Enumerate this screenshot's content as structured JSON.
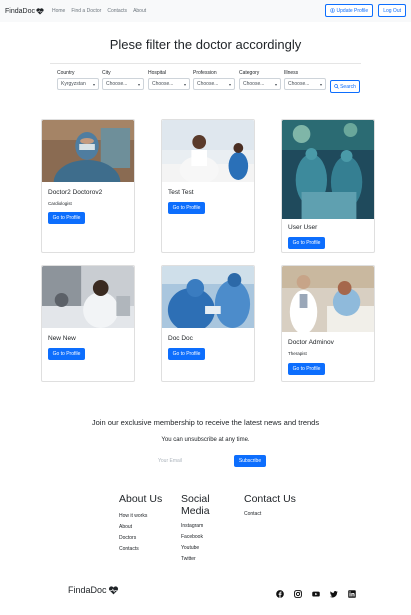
{
  "navbar": {
    "brand": "FindaDoc",
    "links": [
      "Home",
      "Find a Doctor",
      "Contacts",
      "About"
    ],
    "update_profile": "Update Profile",
    "logout": "Log Out"
  },
  "page_title": "Plese filter the doctor accordingly",
  "filters": [
    {
      "label": "Country",
      "value": "Kyrgyzstan"
    },
    {
      "label": "City",
      "value": "Choose..."
    },
    {
      "label": "Hospital",
      "value": "Choose..."
    },
    {
      "label": "Profession",
      "value": "Choose..."
    },
    {
      "label": "Category",
      "value": "Choose..."
    },
    {
      "label": "Illness",
      "value": "Choose..."
    }
  ],
  "search_label": "Search",
  "doctors": [
    {
      "name": "Doctor2 Doctorov2",
      "specialty": "Cardiologist",
      "button": "Go to Profile"
    },
    {
      "name": "Test Test",
      "specialty": "",
      "button": "Go to Profile"
    },
    {
      "name": "User User",
      "specialty": "",
      "button": "Go to Profile"
    },
    {
      "name": "New New",
      "specialty": "",
      "button": "Go to Profile"
    },
    {
      "name": "Doc Doc",
      "specialty": "",
      "button": "Go to Profile"
    },
    {
      "name": "Doctor Adminov",
      "specialty": "Therapist",
      "button": "Go to Profile"
    }
  ],
  "newsletter": {
    "title": "Join our exclusive membership to receive the latest news and trends",
    "subtitle": "You can unsubscribe at any time.",
    "placeholder": "Your Email",
    "button": "Subscribe"
  },
  "footer": {
    "about": {
      "heading": "About Us",
      "links": [
        "How it works",
        "About",
        "Doctors",
        "Contacts"
      ]
    },
    "social": {
      "heading_line1": "Social",
      "heading_line2": "Media",
      "links": [
        "Instagram",
        "Facebook",
        "Youtube",
        "Twitter"
      ]
    },
    "contact": {
      "heading": "Contact Us",
      "links": [
        "Contact"
      ]
    },
    "brand": "FindaDoc",
    "social_icons": [
      "facebook-icon",
      "instagram-icon",
      "youtube-icon",
      "twitter-icon",
      "linkedin-icon"
    ]
  },
  "colors": {
    "primary": "#0d6efd",
    "navbar_bg": "#f8f9fa",
    "text": "#212529"
  }
}
